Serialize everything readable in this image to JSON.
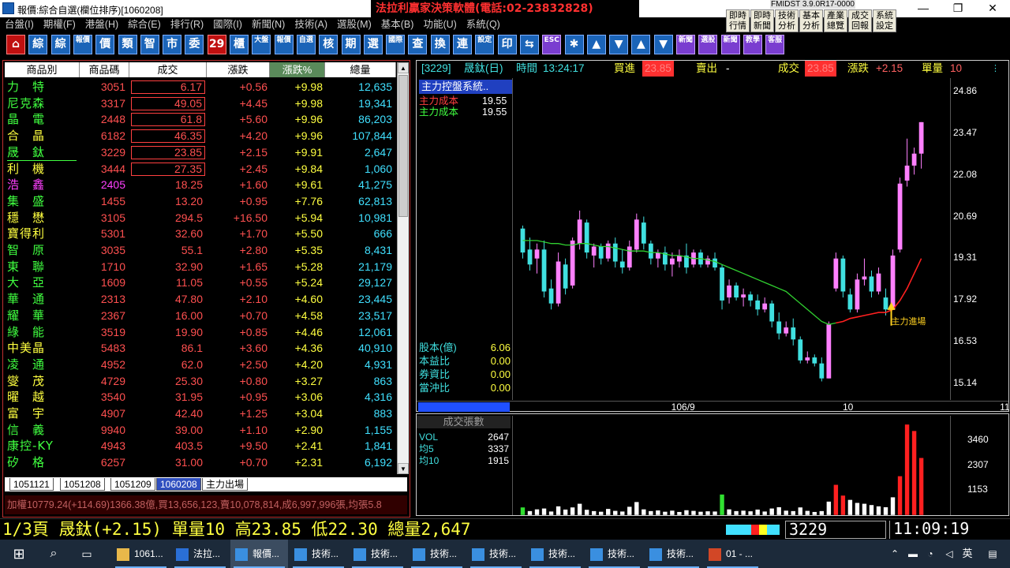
{
  "window": {
    "title": "報價:綜合自選(欄位排序)[1060208]",
    "banner": "法拉利贏家決策軟體(電話:02-23832828)",
    "version": "FMIDST 3.9.0R17-0000",
    "controls": {
      "minimize": "—",
      "restore": "❐",
      "close": "✕"
    }
  },
  "menu": [
    "台盤(I)",
    "期權(F)",
    "港盤(H)",
    "綜合(E)",
    "排行(R)",
    "國際(I)",
    "新聞(N)",
    "技術(A)",
    "選股(M)",
    "基本(B)",
    "功能(U)",
    "系統(Q)"
  ],
  "quick_buttons": [
    [
      "即時",
      "行情"
    ],
    [
      "即時",
      "新聞"
    ],
    [
      "技術",
      "分析"
    ],
    [
      "基本",
      "分析"
    ],
    [
      "產業",
      "總覽"
    ],
    [
      "成交",
      "回報"
    ],
    [
      "系統",
      "設定"
    ]
  ],
  "toolbar": [
    "⌂",
    "綜",
    "綜",
    "報價",
    "價",
    "類",
    "智",
    "市",
    "委",
    "29",
    "櫃",
    "大盤",
    "報價",
    "自選",
    "核",
    "期",
    "選",
    "國際",
    "查",
    "換",
    "連",
    "設定",
    "印",
    "⇆",
    "ESC",
    "✱",
    "▲",
    "▼",
    "▲",
    "▼",
    "新聞",
    "選股",
    "新聞",
    "教學",
    "客服"
  ],
  "table": {
    "headers": [
      "商品別",
      "商品碼",
      "成交",
      "漲跌",
      "漲跌%",
      "總量"
    ],
    "rows": [
      {
        "name": "力　特",
        "code": "3051",
        "price": "6.17",
        "chg": "+0.56",
        "pct": "+9.98",
        "vol": "12,635",
        "color": "#40ff40",
        "box": true
      },
      {
        "name": "尼克森",
        "code": "3317",
        "price": "49.05",
        "chg": "+4.45",
        "pct": "+9.98",
        "vol": "19,341",
        "color": "#40ff40",
        "box": true
      },
      {
        "name": "晶　電",
        "code": "2448",
        "price": "61.8",
        "chg": "+5.60",
        "pct": "+9.96",
        "vol": "86,203",
        "color": "#40ff40",
        "box": true
      },
      {
        "name": "合　晶",
        "code": "6182",
        "price": "46.35",
        "chg": "+4.20",
        "pct": "+9.96",
        "vol": "107,844",
        "color": "#ffff40",
        "box": true
      },
      {
        "name": "晟　鈦",
        "code": "3229",
        "price": "23.85",
        "chg": "+2.15",
        "pct": "+9.91",
        "vol": "2,647",
        "color": "#40ff40",
        "box": true,
        "underline": true
      },
      {
        "name": "利　機",
        "code": "3444",
        "price": "27.35",
        "chg": "+2.45",
        "pct": "+9.84",
        "vol": "1,060",
        "color": "#ffff40",
        "box": true
      },
      {
        "name": "浩　鑫",
        "code": "2405",
        "price": "18.25",
        "chg": "+1.60",
        "pct": "+9.61",
        "vol": "41,275",
        "color": "#ff40ff",
        "codecolor": "#ff40ff"
      },
      {
        "name": "集　盛",
        "code": "1455",
        "price": "13.20",
        "chg": "+0.95",
        "pct": "+7.76",
        "vol": "62,813",
        "color": "#40ff40"
      },
      {
        "name": "穩　懋",
        "code": "3105",
        "price": "294.5",
        "chg": "+16.50",
        "pct": "+5.94",
        "vol": "10,981",
        "color": "#ffff40"
      },
      {
        "name": "寶得利",
        "code": "5301",
        "price": "32.60",
        "chg": "+1.70",
        "pct": "+5.50",
        "vol": "666",
        "color": "#ffff40"
      },
      {
        "name": "智　原",
        "code": "3035",
        "price": "55.1",
        "chg": "+2.80",
        "pct": "+5.35",
        "vol": "8,431",
        "color": "#40ff40"
      },
      {
        "name": "東　聯",
        "code": "1710",
        "price": "32.90",
        "chg": "+1.65",
        "pct": "+5.28",
        "vol": "21,179",
        "color": "#40ff40"
      },
      {
        "name": "大　亞",
        "code": "1609",
        "price": "11.05",
        "chg": "+0.55",
        "pct": "+5.24",
        "vol": "29,127",
        "color": "#40ff40"
      },
      {
        "name": "華　通",
        "code": "2313",
        "price": "47.80",
        "chg": "+2.10",
        "pct": "+4.60",
        "vol": "23,445",
        "color": "#40ff40"
      },
      {
        "name": "耀　華",
        "code": "2367",
        "price": "16.00",
        "chg": "+0.70",
        "pct": "+4.58",
        "vol": "23,517",
        "color": "#40ff40"
      },
      {
        "name": "綠　能",
        "code": "3519",
        "price": "19.90",
        "chg": "+0.85",
        "pct": "+4.46",
        "vol": "12,061",
        "color": "#40ff40"
      },
      {
        "name": "中美晶",
        "code": "5483",
        "price": "86.1",
        "chg": "+3.60",
        "pct": "+4.36",
        "vol": "40,910",
        "color": "#ffff40"
      },
      {
        "name": "凌　通",
        "code": "4952",
        "price": "62.0",
        "chg": "+2.50",
        "pct": "+4.20",
        "vol": "4,931",
        "color": "#40ff40"
      },
      {
        "name": "燮　茂",
        "code": "4729",
        "price": "25.30",
        "chg": "+0.80",
        "pct": "+3.27",
        "vol": "863",
        "color": "#ffff40"
      },
      {
        "name": "曜　越",
        "code": "3540",
        "price": "31.95",
        "chg": "+0.95",
        "pct": "+3.06",
        "vol": "4,316",
        "color": "#ffff40"
      },
      {
        "name": "富　宇",
        "code": "4907",
        "price": "42.40",
        "chg": "+1.25",
        "pct": "+3.04",
        "vol": "883",
        "color": "#ffff40"
      },
      {
        "name": "信　義",
        "code": "9940",
        "price": "39.00",
        "chg": "+1.10",
        "pct": "+2.90",
        "vol": "1,155",
        "color": "#40ff40"
      },
      {
        "name": "康控-KY",
        "code": "4943",
        "price": "403.5",
        "chg": "+9.50",
        "pct": "+2.41",
        "vol": "1,841",
        "color": "#40ff40"
      },
      {
        "name": "矽　格",
        "code": "6257",
        "price": "31.00",
        "chg": "+0.70",
        "pct": "+2.31",
        "vol": "6,192",
        "color": "#40ff40"
      }
    ]
  },
  "sheet_tabs": [
    "1051121",
    "1051208",
    "1051209",
    "1060208",
    "主力出場"
  ],
  "sheet_active": 3,
  "index_line": "加權10779.24(+114.69)1366.38億,買13,656,123,賣10,078,814,成6,997,996張,均張5.8",
  "chart_header": {
    "symbol": "[3229]",
    "name": "晟鈦(日)",
    "time_label": "時間",
    "time": "13:24:17",
    "bid_label": "買進",
    "bid": "23.85",
    "ask_label": "賣出",
    "ask": "-",
    "last_label": "成交",
    "last": "23.85",
    "chg_label": "漲跌",
    "chg": "+2.15",
    "unit_label": "單量",
    "unit": "10"
  },
  "indicator_title": "主力控盤系統..",
  "cost_rows": [
    {
      "label": "主力成本",
      "value": "19.55",
      "color": "#ff4040"
    },
    {
      "label": "主力成本",
      "value": "19.55",
      "color": "#40ff40"
    }
  ],
  "fundamentals": [
    {
      "label": "股本(億)",
      "value": "6.06"
    },
    {
      "label": "本益比",
      "value": "0.00"
    },
    {
      "label": "券資比",
      "value": "0.00"
    },
    {
      "label": "當沖比",
      "value": "0.00"
    }
  ],
  "annotation": "主力進場",
  "volume_panel": {
    "title": "成交張數",
    "rows": [
      {
        "label": "VOL",
        "value": "2647"
      },
      {
        "label": "均5",
        "value": "3337"
      },
      {
        "label": "均10",
        "value": "1915"
      }
    ],
    "yticks": [
      3460,
      2307,
      1153
    ]
  },
  "status": {
    "text": "1/3頁 晟鈦(+2.15) 單量10 高23.85 低22.30 總量2,647",
    "code": "3229",
    "clock": "11:09:19"
  },
  "taskbar": [
    {
      "label": "1061...",
      "icon": "folder-icon"
    },
    {
      "label": "法拉...",
      "icon": "app-icon"
    },
    {
      "label": "報價...",
      "icon": "chart-icon",
      "active": true
    },
    {
      "label": "技術...",
      "icon": "chart-icon"
    },
    {
      "label": "技術...",
      "icon": "chart-icon"
    },
    {
      "label": "技術...",
      "icon": "chart-icon"
    },
    {
      "label": "技術...",
      "icon": "chart-icon"
    },
    {
      "label": "技術...",
      "icon": "chart-icon"
    },
    {
      "label": "技術...",
      "icon": "chart-icon"
    },
    {
      "label": "技術...",
      "icon": "chart-icon"
    },
    {
      "label": "01 - ...",
      "icon": "ppt-icon"
    }
  ],
  "tray": {
    "lang": "英"
  },
  "chart_data": [
    {
      "type": "candlestick",
      "title": "",
      "ylim": [
        14.6,
        25.3
      ],
      "yticks": [
        24.86,
        23.47,
        22.08,
        20.69,
        19.31,
        17.92,
        16.53,
        15.14
      ],
      "xticks": [
        {
          "label": "106/9",
          "index": 22
        },
        {
          "label": "10",
          "index": 46
        },
        {
          "label": "11",
          "index": 68
        }
      ],
      "up_color": "#ff80ff",
      "down_color": "#40e0e0",
      "ohlc": [
        [
          20.3,
          20.4,
          19.3,
          19.5
        ],
        [
          19.6,
          20.0,
          18.9,
          19.1
        ],
        [
          19.3,
          19.8,
          18.8,
          19.6
        ],
        [
          19.6,
          19.9,
          18.0,
          18.2
        ],
        [
          18.3,
          18.6,
          17.6,
          17.8
        ],
        [
          17.8,
          19.5,
          17.7,
          19.2
        ],
        [
          19.1,
          19.3,
          18.1,
          18.3
        ],
        [
          18.4,
          20.0,
          18.3,
          19.9
        ],
        [
          19.8,
          20.9,
          19.6,
          20.6
        ],
        [
          20.5,
          20.6,
          19.3,
          19.5
        ],
        [
          19.4,
          19.8,
          19.0,
          19.7
        ],
        [
          19.7,
          19.8,
          19.1,
          19.3
        ],
        [
          19.3,
          19.9,
          19.2,
          19.8
        ],
        [
          19.8,
          20.0,
          19.0,
          19.2
        ],
        [
          19.2,
          19.6,
          18.8,
          19.0
        ],
        [
          19.0,
          19.9,
          18.9,
          19.7
        ],
        [
          19.6,
          20.8,
          19.5,
          20.6
        ],
        [
          20.5,
          20.7,
          19.6,
          19.8
        ],
        [
          19.8,
          19.9,
          19.1,
          19.3
        ],
        [
          19.3,
          19.6,
          19.0,
          19.5
        ],
        [
          19.5,
          19.7,
          18.9,
          19.1
        ],
        [
          19.1,
          19.5,
          18.7,
          19.3
        ],
        [
          19.2,
          19.6,
          19.0,
          19.4
        ],
        [
          19.4,
          19.8,
          18.8,
          19.0
        ],
        [
          19.1,
          19.6,
          19.0,
          19.5
        ],
        [
          19.5,
          19.6,
          19.0,
          19.1
        ],
        [
          19.1,
          19.4,
          19.0,
          19.3
        ],
        [
          19.3,
          19.5,
          18.9,
          19.0
        ],
        [
          19.0,
          19.1,
          17.6,
          17.9
        ],
        [
          18.0,
          18.6,
          17.8,
          18.4
        ],
        [
          18.4,
          18.5,
          17.9,
          18.0
        ],
        [
          18.0,
          18.3,
          17.7,
          18.1
        ],
        [
          18.1,
          18.2,
          17.7,
          17.9
        ],
        [
          17.9,
          18.1,
          17.4,
          17.6
        ],
        [
          17.6,
          18.0,
          17.5,
          17.8
        ],
        [
          17.8,
          17.9,
          17.0,
          17.2
        ],
        [
          17.2,
          17.5,
          16.6,
          16.8
        ],
        [
          16.8,
          17.2,
          16.7,
          17.0
        ],
        [
          17.0,
          17.3,
          16.4,
          16.6
        ],
        [
          16.6,
          16.7,
          15.8,
          15.9
        ],
        [
          15.9,
          16.2,
          15.8,
          16.0
        ],
        [
          16.0,
          16.1,
          15.7,
          15.8
        ],
        [
          15.8,
          16.0,
          15.2,
          15.3
        ],
        [
          15.3,
          17.2,
          15.3,
          17.1
        ],
        [
          18.3,
          19.5,
          18.2,
          19.3
        ],
        [
          19.3,
          19.4,
          18.0,
          18.2
        ],
        [
          18.1,
          18.3,
          17.5,
          17.6
        ],
        [
          17.6,
          18.8,
          17.5,
          18.6
        ],
        [
          18.6,
          19.3,
          18.4,
          18.7
        ],
        [
          18.7,
          18.9,
          18.0,
          18.2
        ],
        [
          18.2,
          19.0,
          18.1,
          18.8
        ],
        [
          18.0,
          18.3,
          17.4,
          17.6
        ],
        [
          17.6,
          19.6,
          17.6,
          19.4
        ],
        [
          19.6,
          22.0,
          19.5,
          21.8
        ],
        [
          21.9,
          23.3,
          21.7,
          22.4
        ],
        [
          22.4,
          23.0,
          22.1,
          22.8
        ],
        [
          22.8,
          23.85,
          22.3,
          23.85
        ]
      ],
      "ma": [
        19.9,
        19.9,
        19.9,
        19.85,
        19.8,
        19.8,
        19.75,
        19.75,
        19.8,
        19.8,
        19.75,
        19.7,
        19.7,
        19.65,
        19.6,
        19.55,
        19.55,
        19.55,
        19.5,
        19.5,
        19.45,
        19.4,
        19.4,
        19.35,
        19.3,
        19.3,
        19.25,
        19.2,
        19.1,
        19.0,
        18.9,
        18.8,
        18.7,
        18.6,
        18.5,
        18.4,
        18.3,
        18.2,
        18.0,
        17.8,
        17.6,
        17.4,
        17.2,
        17.1,
        17.15,
        17.2,
        17.3,
        17.35,
        17.4,
        17.45,
        17.5,
        17.5,
        17.6,
        17.9,
        18.3,
        18.8,
        19.3
      ],
      "ma_split": 44
    },
    {
      "type": "bar",
      "title": "成交張數",
      "ylim": [
        0,
        4600
      ],
      "values": [
        350,
        180,
        260,
        300,
        160,
        400,
        250,
        350,
        520,
        240,
        180,
        150,
        280,
        190,
        160,
        380,
        600,
        260,
        180,
        210,
        150,
        200,
        140,
        220,
        190,
        150,
        170,
        160,
        950,
        260,
        180,
        200,
        170,
        250,
        160,
        300,
        360,
        200,
        180,
        350,
        190,
        140,
        180,
        620,
        1400,
        900,
        700,
        560,
        520,
        460,
        400,
        360,
        820,
        1800,
        4200,
        3900,
        2647
      ],
      "colors_index": [
        "g",
        "r",
        "r",
        "r",
        "r",
        "r",
        "r",
        "r",
        "r",
        "r",
        "r",
        "r",
        "r",
        "r",
        "r",
        "r",
        "r",
        "r",
        "r",
        "r",
        "r",
        "r",
        "r",
        "r",
        "r",
        "r",
        "r",
        "r",
        "g",
        "r",
        "r",
        "r",
        "r",
        "r",
        "r",
        "r",
        "r",
        "r",
        "r",
        "r",
        "r",
        "r",
        "r",
        "r",
        "r",
        "r",
        "r",
        "r",
        "r",
        "r",
        "r",
        "r",
        "r",
        "r",
        "r",
        "r",
        "r"
      ]
    }
  ]
}
